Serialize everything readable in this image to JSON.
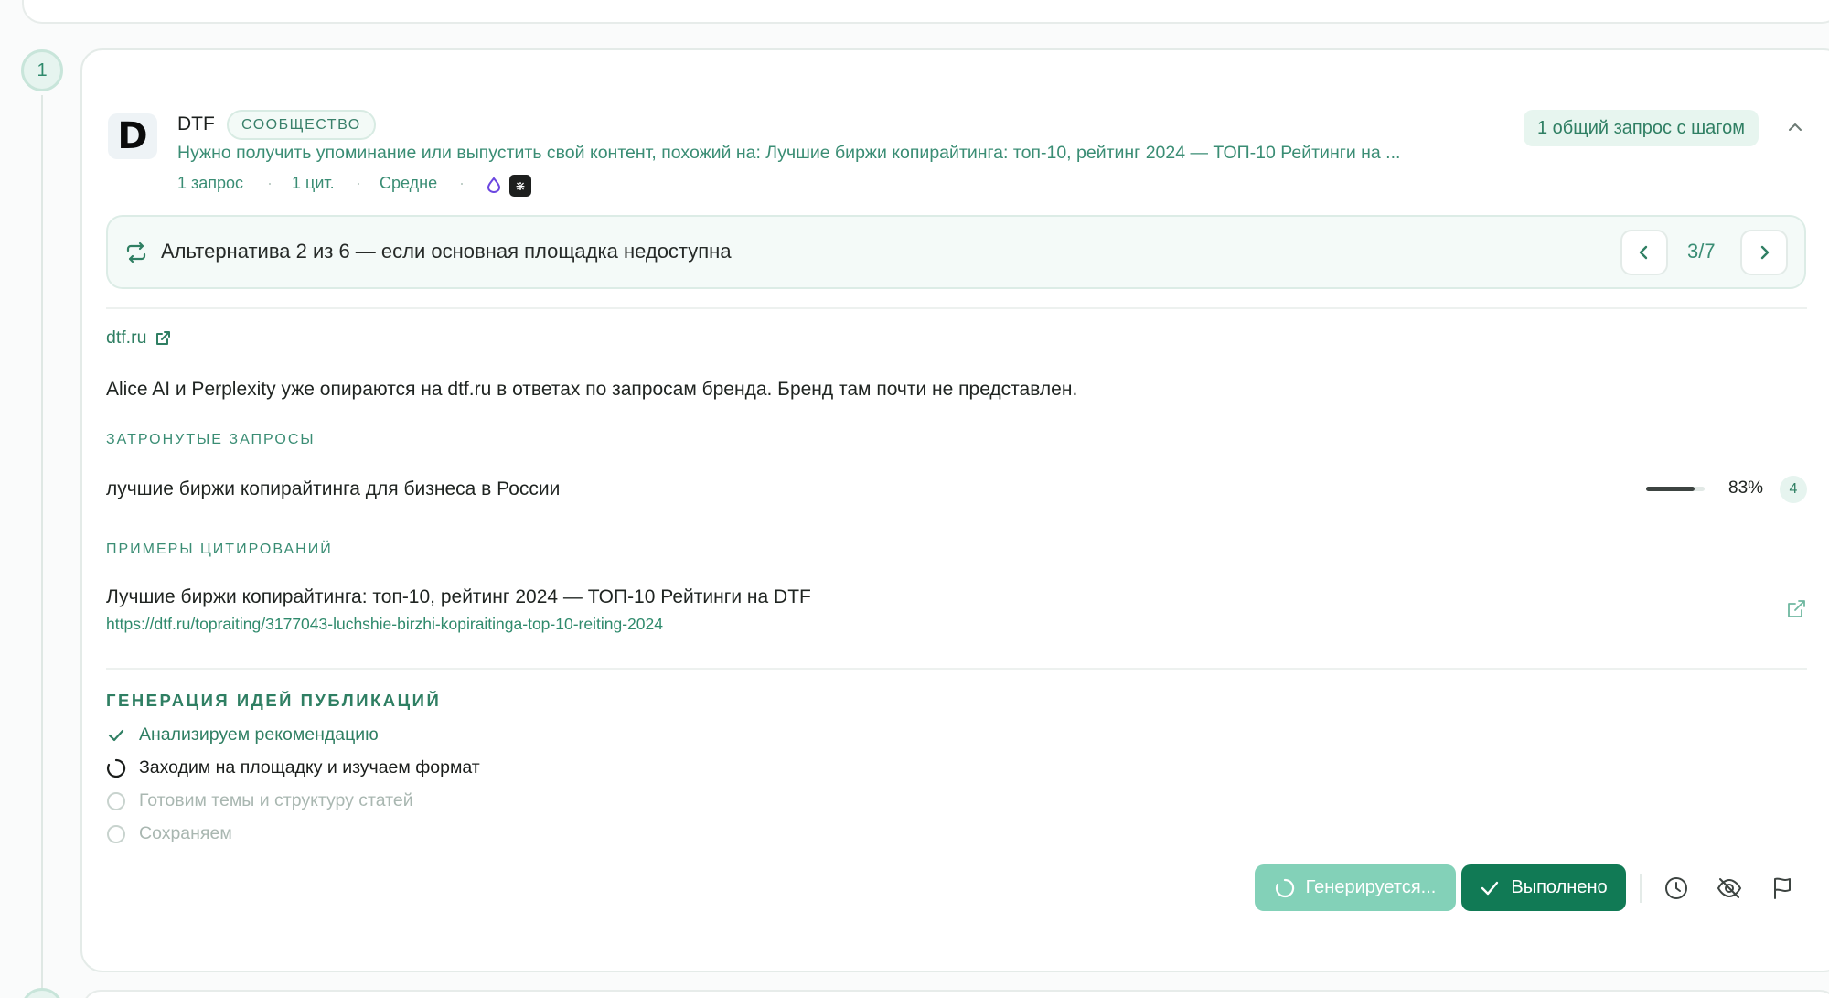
{
  "step_number": "1",
  "source": {
    "logo_letter": "D",
    "name": "DTF",
    "type_badge": "СООБЩЕСТВО",
    "description": "Нужно получить упоминание или выпустить свой контент, похожий на: Лучшие биржи копирайтинга: топ-10, рейтинг 2024 — ТОП-10 Рейтинги на ...",
    "meta": {
      "queries": "1 запрос",
      "citations": "1 цит.",
      "difficulty": "Средне",
      "separator": "·"
    },
    "engine_icons": [
      "alice-drop-icon",
      "perplexity-icon"
    ],
    "perplexity_glyph": "⋇",
    "shared_badge": "1 общий запрос с шагом"
  },
  "alternative": {
    "text": "Альтернатива 2 из 6 — если основная площадка недоступна",
    "page": "3/7"
  },
  "site": {
    "domain": "dtf.ru",
    "summary": "Alice AI и Perplexity уже опираются на dtf.ru в ответах по запросам бренда. Бренд там почти не представлен."
  },
  "affected_queries": {
    "label": "ЗАТРОНУТЫЕ ЗАПРОСЫ",
    "items": [
      {
        "text": "лучшие биржи копирайтинга для бизнеса в России",
        "percent": "83%",
        "share": 0.83,
        "count": "4"
      }
    ]
  },
  "citations": {
    "label": "ПРИМЕРЫ ЦИТИРОВАНИЙ",
    "items": [
      {
        "title": "Лучшие биржи копирайтинга: топ-10, рейтинг 2024 — ТОП-10 Рейтинги на DTF",
        "url": "https://dtf.ru/topraiting/3177043-luchshie-birzhi-kopiraitinga-top-10-reiting-2024"
      }
    ]
  },
  "generation": {
    "title": "ГЕНЕРАЦИЯ ИДЕЙ ПУБЛИКАЦИЙ",
    "steps": [
      {
        "label": "Анализируем рекомендацию",
        "state": "done"
      },
      {
        "label": "Заходим на площадку и изучаем формат",
        "state": "active"
      },
      {
        "label": "Готовим темы и структуру статей",
        "state": "pending"
      },
      {
        "label": "Сохраняем",
        "state": "pending"
      }
    ]
  },
  "actions": {
    "generating": "Генерируется...",
    "done": "Выполнено",
    "icons": [
      "clock-icon",
      "hide-icon",
      "flag-icon"
    ]
  },
  "colors": {
    "accent": "#117a55",
    "accent_light": "#83d1b8",
    "accent_text": "#2f7f63",
    "badge_bg": "#e7f5ef"
  }
}
